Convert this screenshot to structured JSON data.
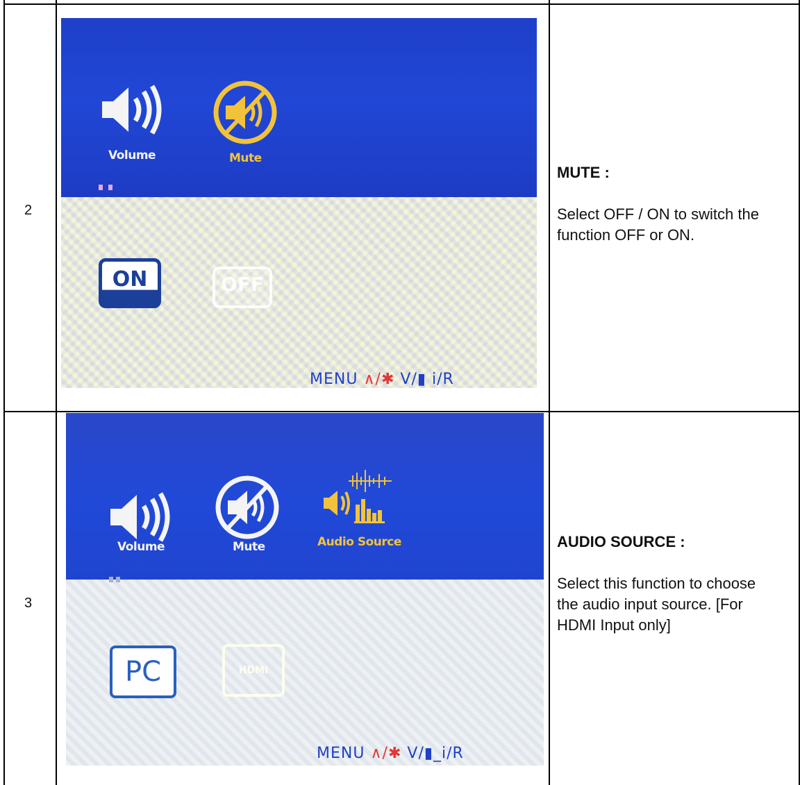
{
  "rows": [
    {
      "number": "2",
      "heading": "MUTE :",
      "body": "Select OFF / ON to switch the function OFF or ON.",
      "osd": {
        "icons": [
          "Volume",
          "Mute"
        ],
        "options": [
          "ON",
          "OFF"
        ],
        "footer": {
          "menu": "MENU",
          "up": "∧/",
          "star": "✱",
          "down": "V/",
          "speaker": "▮",
          "ir": " i/R"
        }
      }
    },
    {
      "number": "3",
      "heading": "AUDIO SOURCE :",
      "body": "Select this function to choose the audio input source. [For HDMI Input only]",
      "osd": {
        "icons": [
          "Volume",
          "Mute",
          "Audio Source"
        ],
        "options": [
          "PC",
          "HDMI"
        ],
        "footer": {
          "menu": "MENU",
          "up": "∧/",
          "star": "✱",
          "down": "V/",
          "speaker": "▮",
          "ir": "_i/R"
        }
      }
    }
  ],
  "colors": {
    "osd_blue": "#2147d6",
    "highlight_yellow": "#f2c33a",
    "footer_blue": "#1f3fc6",
    "footer_red": "#e53535"
  },
  "icon_names": [
    "speaker-volume-icon",
    "mute-icon",
    "audio-source-icon"
  ]
}
